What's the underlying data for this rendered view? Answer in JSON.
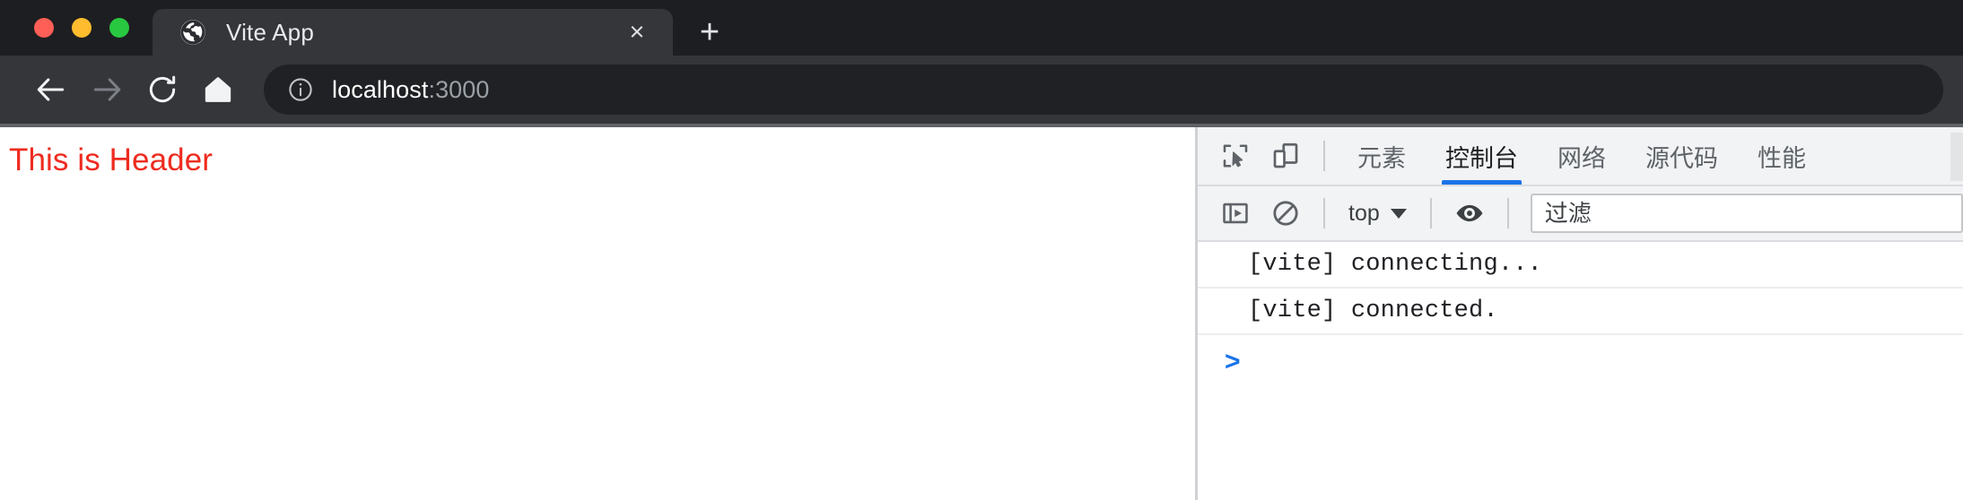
{
  "browser": {
    "traffic_lights": [
      {
        "name": "close",
        "color": "#ff5f57"
      },
      {
        "name": "minimize",
        "color": "#febc2e"
      },
      {
        "name": "maximize",
        "color": "#28c840"
      }
    ],
    "tab": {
      "title": "Vite App",
      "favicon_icon": "globe-icon",
      "close_icon": "close-icon",
      "close_label": "×"
    },
    "new_tab_label": "+",
    "nav": {
      "back_icon": "back-arrow-icon",
      "forward_icon": "forward-arrow-icon",
      "reload_icon": "reload-icon",
      "home_icon": "home-icon"
    },
    "omnibox": {
      "info_icon": "info-circle-icon",
      "host": "localhost",
      "port": ":3000",
      "full_url": "localhost:3000"
    }
  },
  "page": {
    "header_text": "This is Header",
    "header_color": "#ee2b1f"
  },
  "devtools": {
    "accent_color": "#1a73e8",
    "toolbar_icons": [
      {
        "name": "inspect-element-icon",
        "title": "检查"
      },
      {
        "name": "device-toolbar-icon",
        "title": "设备工具栏"
      }
    ],
    "tabs": [
      {
        "label": "元素",
        "active": false
      },
      {
        "label": "控制台",
        "active": true
      },
      {
        "label": "网络",
        "active": false
      },
      {
        "label": "源代码",
        "active": false
      },
      {
        "label": "性能",
        "active": false
      }
    ],
    "console_toolbar": {
      "sidebar_icon": "console-sidebar-icon",
      "clear_icon": "clear-console-icon",
      "context_label": "top",
      "context_caret": "caret-down-icon",
      "eye_icon": "live-expression-eye-icon",
      "filter_placeholder": "过滤",
      "filter_value": ""
    },
    "console_messages": [
      {
        "text": "[vite] connecting..."
      },
      {
        "text": "[vite] connected."
      }
    ],
    "prompt_caret": ">"
  }
}
